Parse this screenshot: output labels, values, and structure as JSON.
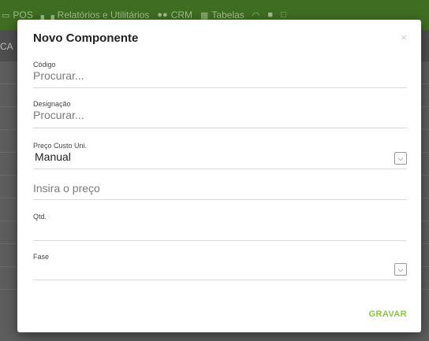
{
  "app": {
    "nav": [
      {
        "label": "POS",
        "icon": "monitor-icon"
      },
      {
        "label": "Relatórios e Utilitários",
        "icon": "bar-chart-icon"
      },
      {
        "label": "CRM",
        "icon": "users-icon"
      },
      {
        "label": "Tabelas",
        "icon": "table-icon"
      },
      {
        "label": "",
        "icon": "headset-icon"
      },
      {
        "label": "",
        "icon": "square-icon"
      },
      {
        "label": "",
        "icon": "window-icon"
      }
    ],
    "subbar_fragment": "CA"
  },
  "modal": {
    "title": "Novo Componente",
    "close_label": "×",
    "fields": {
      "codigo": {
        "label": "Código",
        "placeholder": "Procurar..."
      },
      "designacao": {
        "label": "Designação",
        "placeholder": "Procurar..."
      },
      "preco_custo": {
        "label": "Preço Custo Uni.",
        "selected": "Manual"
      },
      "preco": {
        "placeholder": "Insira o preço"
      },
      "qtd": {
        "label": "Qtd.",
        "value": ""
      },
      "fase": {
        "label": "Fase",
        "selected": ""
      }
    },
    "save_label": "GRAVAR"
  },
  "colors": {
    "topbar": "#3f6e22",
    "accent": "#8bc34a"
  }
}
